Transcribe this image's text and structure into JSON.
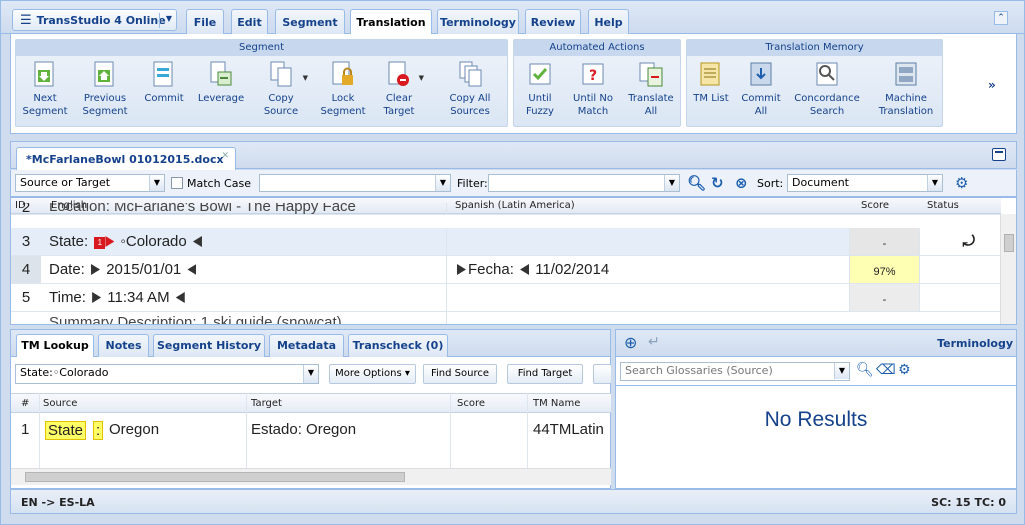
{
  "app": {
    "title": "TransStudio 4 Online"
  },
  "menu_tabs": [
    {
      "label": "File"
    },
    {
      "label": "Edit"
    },
    {
      "label": "Segment"
    },
    {
      "label": "Translation",
      "active": true
    },
    {
      "label": "Terminology"
    },
    {
      "label": "Review"
    },
    {
      "label": "Help"
    }
  ],
  "ribbon": {
    "groups": {
      "segment": "Segment",
      "automated": "Automated Actions",
      "tm": "Translation Memory"
    },
    "buttons": {
      "next_segment": "Next Segment",
      "previous_segment": "Previous Segment",
      "commit": "Commit",
      "leverage": "Leverage",
      "copy_source": "Copy Source",
      "lock_segment": "Lock Segment",
      "clear_target": "Clear Target",
      "copy_all_sources": "Copy All Sources",
      "until_fuzzy": "Until Fuzzy",
      "until_no_match": "Until No Match",
      "translate_all": "Translate All",
      "tm_list": "TM List",
      "commit_all": "Commit All",
      "concordance_search": "Concordance Search",
      "machine_translation": "Machine Translation"
    },
    "more": "»"
  },
  "document_tab": {
    "label": "*McFarlaneBowl 01012015.docx"
  },
  "grid_toolbar": {
    "scope_value": "Source or Target",
    "match_case_label": "Match Case",
    "filter_label": "Filter:",
    "sort_label": "Sort:",
    "sort_value": "Document"
  },
  "grid": {
    "columns": {
      "id": "ID",
      "source": "English",
      "target": "Spanish (Latin America)",
      "score": "Score",
      "status": "Status"
    },
    "partial_row": {
      "id": "2",
      "source": "Location:  McFarlane's Bowl - The Happy Face"
    },
    "rows": [
      {
        "id": "3",
        "source_label": "State:",
        "tag": "1",
        "source_value": "◦Colorado",
        "target_label": "",
        "target_value": "",
        "score": "-",
        "status": "⤾"
      },
      {
        "id": "4",
        "source_label": "Date:",
        "tag": "",
        "source_value": "2015/01/01",
        "target_label": "Fecha:",
        "target_value": "11/02/2014",
        "score": "97%",
        "status": ""
      },
      {
        "id": "5",
        "source_label": "Time:",
        "tag": "",
        "source_value": "11:34 AM",
        "target_label": "",
        "target_value": "",
        "score": "-",
        "status": ""
      }
    ],
    "partial_bottom": "Summary Description:  1 ski guide (snowcat)"
  },
  "tm_panel": {
    "tabs": [
      "TM Lookup",
      "Notes",
      "Segment History",
      "Metadata",
      "Transcheck (0)"
    ],
    "query": "State:◦Colorado",
    "more_options": "More Options ▾",
    "find_source": "Find Source",
    "find_target": "Find Target",
    "columns": {
      "num": "#",
      "source": "Source",
      "target": "Target",
      "score": "Score",
      "tm_name": "TM Name"
    },
    "results": [
      {
        "num": "1",
        "source_highlight": "State",
        "source_colon": ":",
        "source_rest": "Oregon",
        "target": "Estado: Oregon",
        "score": "",
        "tm_name": "44TMLatin"
      }
    ]
  },
  "terminology": {
    "title": "Terminology",
    "search_placeholder": "Search Glossaries (Source)",
    "empty": "No Results"
  },
  "status": {
    "lang_pair": "EN -> ES-LA",
    "counts": "SC: 15 TC: 0"
  },
  "colors": {
    "accent": "#15428b",
    "border": "#99bbe8",
    "highlight": "#ffff66",
    "score_bg": "#ffffb3"
  }
}
